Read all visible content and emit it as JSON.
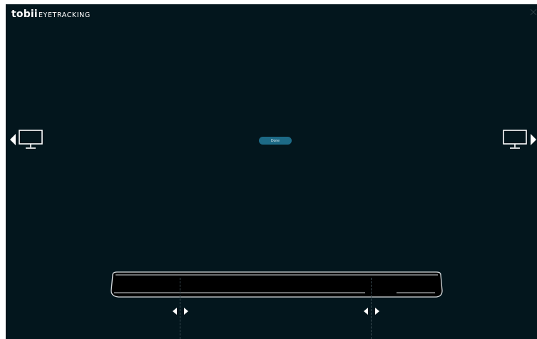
{
  "app": {
    "brand_mark": "tobii",
    "brand_text": "EYETRACKING"
  },
  "nav": {
    "prev_icon": "chevron-left-icon",
    "next_icon": "chevron-right-icon",
    "monitor_icon": "monitor-icon"
  },
  "actions": {
    "done_label": "Done"
  },
  "colors": {
    "background": "#03161d",
    "accent": "#1d6a86",
    "foreground": "#ffffff"
  }
}
